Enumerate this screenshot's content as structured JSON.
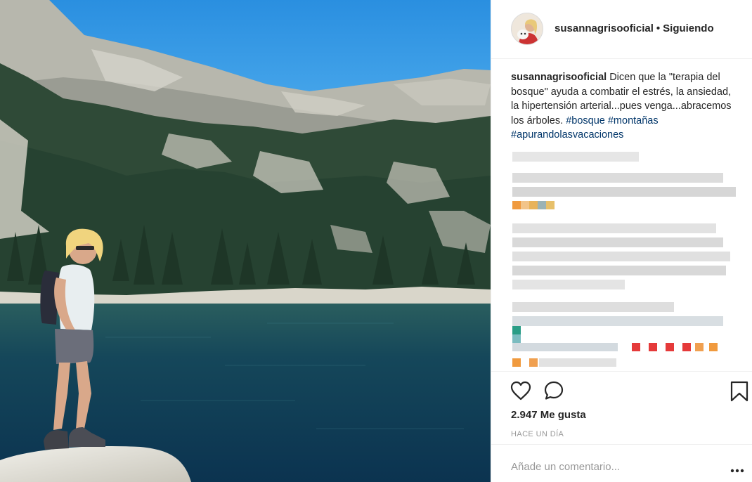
{
  "post": {
    "image_alt": "",
    "username": "susannagrisooficial",
    "separator": "•",
    "follow_status": "Siguiendo",
    "caption": {
      "username": "susannagrisooficial",
      "text": "Dicen que la \"terapia del bosque\" ayuda a combatir el estrés, la ansiedad, la hipertensión arterial...pues venga...abracemos los árboles.",
      "hashtags": [
        "#bosque",
        "#montañas",
        "#apurandolasvacaciones"
      ]
    },
    "comments_blurred": true,
    "actions": {
      "like_icon": "heart-icon",
      "comment_icon": "speech-bubble-icon",
      "save_icon": "bookmark-icon"
    },
    "likes": "2.947 Me gusta",
    "timestamp": "HACE UN DÍA",
    "comment_placeholder": "Añade un comentario...",
    "more_icon": "ellipsis-icon"
  },
  "colors": {
    "text": "#262626",
    "hashtag": "#003569",
    "muted": "#999999",
    "divider": "#efefef",
    "sky": "#2f9be3",
    "lake": "#12465a"
  }
}
